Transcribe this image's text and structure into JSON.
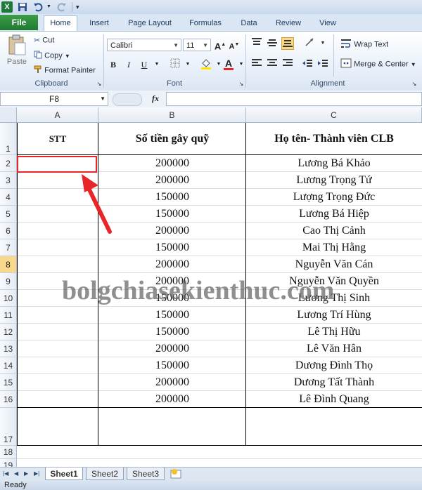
{
  "window": {
    "app_logo": "X"
  },
  "ribbon_tabs": {
    "file": "File",
    "items": [
      "Home",
      "Insert",
      "Page Layout",
      "Formulas",
      "Data",
      "Review",
      "View"
    ],
    "active": "Home"
  },
  "clipboard": {
    "paste": "Paste",
    "cut": "Cut",
    "copy": "Copy",
    "format_painter": "Format Painter",
    "label": "Clipboard"
  },
  "font": {
    "name": "Calibri",
    "size": "11",
    "label": "Font",
    "bold": "B",
    "italic": "I",
    "underline": "U",
    "grow": "A",
    "shrink": "A",
    "font_color_letter": "A"
  },
  "alignment": {
    "wrap_text": "Wrap Text",
    "merge_center": "Merge & Center",
    "label": "Alignment"
  },
  "formula_bar": {
    "name_box": "F8",
    "fx": "fx",
    "value": ""
  },
  "sheet": {
    "columns": [
      "A",
      "B",
      "C"
    ],
    "rows": [
      "1",
      "2",
      "3",
      "4",
      "5",
      "6",
      "7",
      "8",
      "9",
      "10",
      "11",
      "12",
      "13",
      "14",
      "15",
      "16",
      "17",
      "18",
      "19"
    ],
    "selected_row": "8",
    "headers": {
      "stt": "STT",
      "amount": "Số tiền gây quỹ",
      "name": "Họ tên- Thành viên CLB"
    },
    "records": [
      {
        "amount": "200000",
        "name": "Lương Bá Khảo"
      },
      {
        "amount": "200000",
        "name": "Lương Trọng Tứ"
      },
      {
        "amount": "150000",
        "name": "Lượng Trọng Đức"
      },
      {
        "amount": "150000",
        "name": "Lương Bá Hiệp"
      },
      {
        "amount": "200000",
        "name": "Cao Thị Cảnh"
      },
      {
        "amount": "150000",
        "name": "Mai Thị Hằng"
      },
      {
        "amount": "200000",
        "name": "Nguyễn Văn Cán"
      },
      {
        "amount": "200000",
        "name": "Nguyễn Văn Quyền"
      },
      {
        "amount": "150000",
        "name": "Lương Thị Sinh"
      },
      {
        "amount": "150000",
        "name": "Lương Trí Hùng"
      },
      {
        "amount": "150000",
        "name": "Lê Thị Hữu"
      },
      {
        "amount": "200000",
        "name": "Lê Văn Hân"
      },
      {
        "amount": "150000",
        "name": "Dương Đình Thọ"
      },
      {
        "amount": "200000",
        "name": "Dương Tất Thành"
      },
      {
        "amount": "200000",
        "name": "Lê Đình Quang"
      }
    ]
  },
  "watermark": "bolgchiasekienthuc.com",
  "sheet_tabs": [
    "Sheet1",
    "Sheet2",
    "Sheet3"
  ],
  "active_sheet": "Sheet1",
  "status": "Ready",
  "colors": {
    "highlight": "#e8262a",
    "arrow": "#e8262a",
    "selected_row_header": "#f8d98b"
  }
}
